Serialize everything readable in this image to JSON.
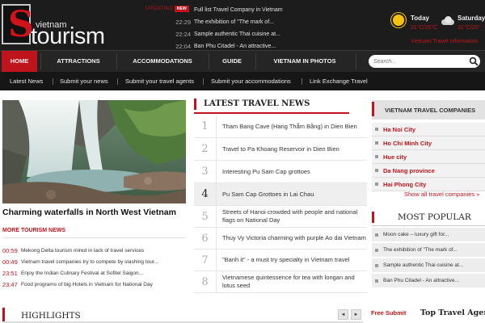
{
  "brand": {
    "logo_letter": "S",
    "logo_top": "vietnam",
    "logo_main": "tourism"
  },
  "ticker": {
    "label": "UPDATING",
    "badge": "NEW",
    "items": [
      {
        "time": "",
        "title": "Full list Travel Company in Vietnam"
      },
      {
        "time": "22:29",
        "title": "The exhibition of \"The mark of..."
      },
      {
        "time": "22:24",
        "title": "Sample authentic Thai cuisine at..."
      },
      {
        "time": "22:04",
        "title": "Ban Phu Citadel - An attractive..."
      }
    ]
  },
  "weather": {
    "days": [
      {
        "day": "Today",
        "temp": "31°C/25°C",
        "icon": "sun-icon"
      },
      {
        "day": "Saturday",
        "temp": "31°C/25°",
        "icon": "cloud-icon"
      }
    ],
    "link": "Vietnam Travel Information"
  },
  "nav": {
    "items": [
      "HOME",
      "ATTRACTIONS",
      "ACCOMMODATIONS",
      "GUIDE",
      "VIETNAM IN PHOTOS"
    ],
    "active": "HOME",
    "search_placeholder": "Search..."
  },
  "subnav": {
    "items": [
      "Latest News",
      "Submit your news",
      "Submit your travel agents",
      "Submit your accommodations",
      "Link Exchange Travel"
    ]
  },
  "feature": {
    "title": "Charming waterfalls in North West Vietnam"
  },
  "more_news": {
    "heading": "MORE TOURISM NEWS",
    "items": [
      {
        "time": "00:59",
        "title": "Mekong Delta tourism mired in lack of travel services"
      },
      {
        "time": "00:49",
        "title": "Vietnam travel companies try to compete by slashing tour..."
      },
      {
        "time": "23:51",
        "title": "Enjoy the Indian Culinary Festival at Sofitel Saigon..."
      },
      {
        "time": "23:47",
        "title": "Food programs of big Hotels in Vietnam for National Day"
      }
    ]
  },
  "latest_news": {
    "heading": "LATEST TRAVEL NEWS",
    "items": [
      {
        "num": "1",
        "title": "Tham Bang Cave (Hang Thẳm Bằng) in Dien Bien"
      },
      {
        "num": "2",
        "title": "Travel to Pa Khoang Reservoir in Dien Bien"
      },
      {
        "num": "3",
        "title": "Interesting Pu Sam Cap grottoes"
      },
      {
        "num": "4",
        "title": "Pu Sam Cap Grottoes in Lai Chau"
      },
      {
        "num": "5",
        "title": "Streets of Hanoi crowded with people and national flags on National Day"
      },
      {
        "num": "6",
        "title": "Thuy Vy Victoria charming with purple Ao dai Vietnam"
      },
      {
        "num": "7",
        "title": "\"Banh it\" - a must try specialty in Vietnam travel"
      },
      {
        "num": "8",
        "title": "Vietnamese quintessence for tea with longan and lotus seed"
      }
    ],
    "highlighted": "4"
  },
  "companies": {
    "heading": "VIETNAM TRAVEL COMPANIES",
    "items": [
      "Ha Noi City",
      "Ho Chi Minh City",
      "Hue city",
      "Da Nang province",
      "Hai Phong City"
    ],
    "more": "Show all travel companies »"
  },
  "most_popular": {
    "heading": "MOST POPULAR",
    "items": [
      "Moon cake – luxury gift for...",
      "The exhibition of \"The mark of...",
      "Sample authentic Thai cuisine at...",
      "Ban Phu Citadel - An attractive..."
    ]
  },
  "bottom": {
    "highlights": "HIGHLIGHTS",
    "prev": "◄",
    "next": "►",
    "free_submit": "Free Submit",
    "top_agents": "Top Travel Agents"
  },
  "colors": {
    "accent": "#c0141c",
    "header_bg": "#1c1c1c",
    "nav_bg": "#252525",
    "subnav_bg": "#161616"
  }
}
